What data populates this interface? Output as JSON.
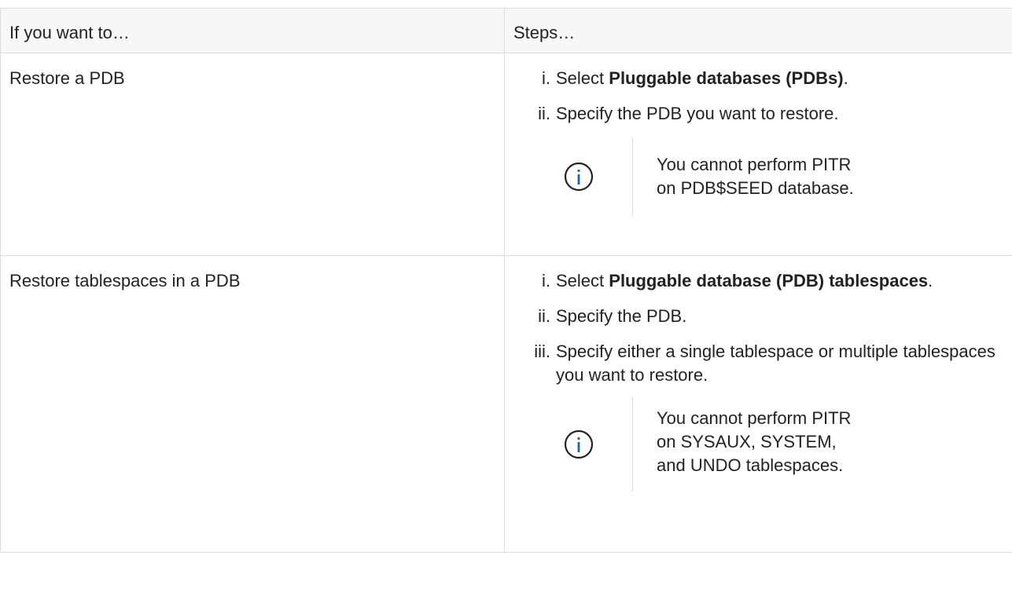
{
  "table": {
    "headers": [
      "If you want to…",
      "Steps…"
    ],
    "rows": [
      {
        "label": "Restore a PDB",
        "steps": [
          {
            "num": "i.",
            "prefix": "Select ",
            "bold": "Pluggable databases (PDBs)",
            "suffix": "."
          },
          {
            "num": "ii.",
            "text": "Specify the PDB you want to restore."
          }
        ],
        "note": {
          "icon": "info-icon",
          "text": "You cannot perform PITR on PDB$SEED database."
        }
      },
      {
        "label": "Restore tablespaces in a PDB",
        "steps": [
          {
            "num": "i.",
            "prefix": "Select ",
            "bold": "Pluggable database (PDB) tablespaces",
            "suffix": "."
          },
          {
            "num": "ii.",
            "text": "Specify the PDB."
          },
          {
            "num": "iii.",
            "text": "Specify either a single tablespace or multiple tablespaces you want to restore."
          }
        ],
        "note": {
          "icon": "info-icon",
          "text": "You cannot perform PITR on SYSAUX, SYSTEM, and UNDO tablespaces."
        }
      }
    ]
  },
  "colors": {
    "text": "#222222",
    "border": "#dcdcdc",
    "header_bg": "#f7f7f7",
    "info_icon": "#1565c0"
  }
}
